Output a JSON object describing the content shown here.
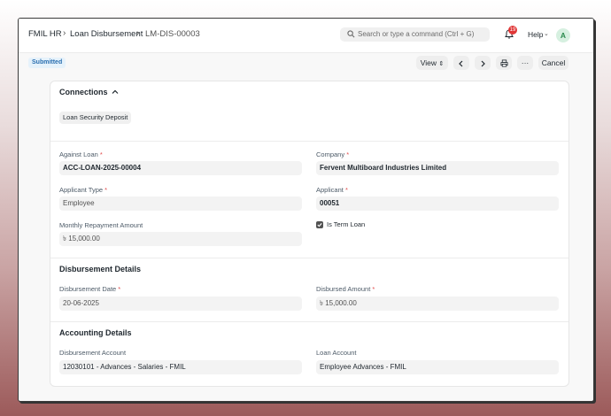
{
  "breadcrumb": [
    "FMIL HR",
    "Loan Disbursement",
    "LM-DIS-00003"
  ],
  "search": {
    "placeholder": "Search or type a command (Ctrl + G)"
  },
  "notifications": {
    "count": "19"
  },
  "help_label": "Help",
  "avatar_initial": "A",
  "status_badge": "Submitted",
  "toolbar": {
    "view_label": "View",
    "cancel_label": "Cancel",
    "more_label": "···"
  },
  "connections": {
    "title": "Connections",
    "chip": "Loan Security Deposit"
  },
  "fields": {
    "against_loan": {
      "label": "Against Loan",
      "value": "ACC-LOAN-2025-00004"
    },
    "company": {
      "label": "Company",
      "value": "Fervent Multiboard Industries Limited"
    },
    "applicant_type": {
      "label": "Applicant Type",
      "value": "Employee"
    },
    "applicant": {
      "label": "Applicant",
      "value": "00051"
    },
    "monthly_repayment": {
      "label": "Monthly Repayment Amount",
      "value": "৳ 15,000.00"
    },
    "is_term_loan": {
      "label": "Is Term Loan",
      "checked": true
    }
  },
  "disbursement": {
    "title": "Disbursement Details",
    "date": {
      "label": "Disbursement Date",
      "value": "20-06-2025"
    },
    "amount": {
      "label": "Disbursed Amount",
      "value": "৳ 15,000.00"
    }
  },
  "accounting": {
    "title": "Accounting Details",
    "disbursement_account": {
      "label": "Disbursement Account",
      "value": "12030101 - Advances - Salaries - FMIL"
    },
    "loan_account": {
      "label": "Loan Account",
      "value": "Employee Advances - FMIL"
    }
  },
  "colors": {
    "accent_blue": "#2a6fb0",
    "badge_red": "#e03636",
    "avatar_green": "#2b8a4e"
  }
}
